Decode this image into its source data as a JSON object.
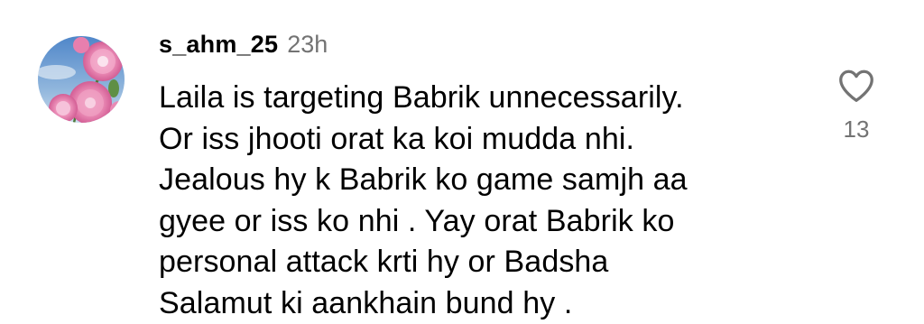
{
  "comment": {
    "username": "s_ahm_25",
    "timestamp": "23h",
    "lines": [
      "Laila is targeting Babrik unnecessarily.",
      "Or iss jhooti orat ka koi mudda nhi.",
      "Jealous hy k Babrik ko game samjh aa",
      "gyee or iss ko nhi . Yay orat Babrik ko",
      "personal attack krti hy or Badsha",
      "Salamut ki aankhain bund hy ."
    ],
    "like_count": "13",
    "like_icon": "heart-outline-icon",
    "avatar_icon": "pink-flowers-avatar"
  },
  "colors": {
    "text": "#000000",
    "secondary_text": "#737373",
    "background": "#ffffff"
  }
}
